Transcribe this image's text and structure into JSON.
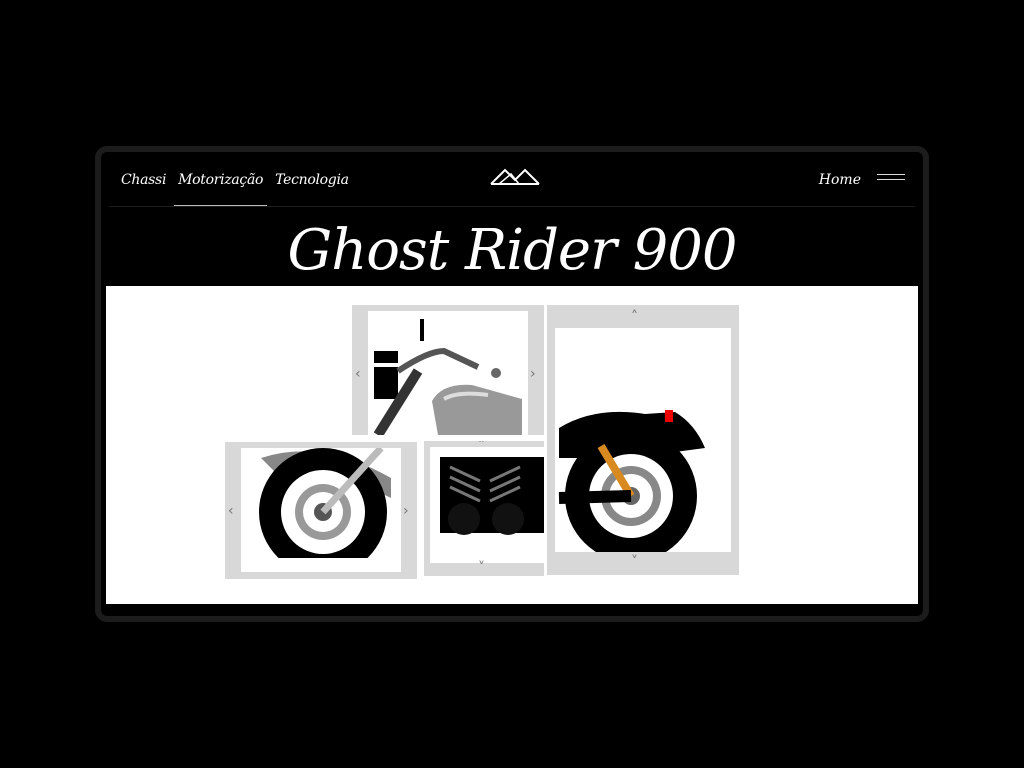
{
  "nav": {
    "items": [
      {
        "label": "Chassi",
        "active": false
      },
      {
        "label": "Motorização",
        "active": true
      },
      {
        "label": "Tecnologia",
        "active": false
      }
    ],
    "home_label": "Home"
  },
  "hero": {
    "title": "Ghost Rider 900"
  },
  "puzzle": {
    "arrow_left": "‹",
    "arrow_right": "›",
    "arrow_up": "˄",
    "arrow_down": "˅"
  },
  "colors": {
    "background": "#000000",
    "frame": "#1c1c1c",
    "tile_border": "#d8d8d8",
    "stage": "#ffffff"
  }
}
